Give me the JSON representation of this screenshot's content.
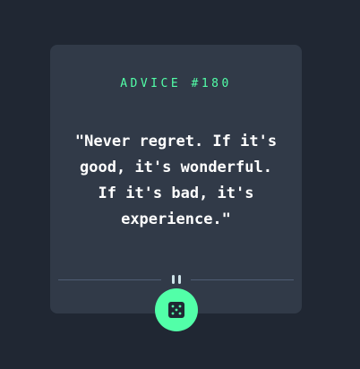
{
  "card": {
    "advice_label": "ADVICE #180",
    "quote": "\"Never regret. If it's good, it's wonderful. If it's bad, it's experience.\""
  },
  "divider": {
    "icon": "pause-icon"
  },
  "dice_button": {
    "icon": "dice-icon",
    "color": "#52ffa8"
  },
  "colors": {
    "background": "#202733",
    "card": "#313a48",
    "accent": "#52ffa8",
    "text": "#ffffff"
  }
}
